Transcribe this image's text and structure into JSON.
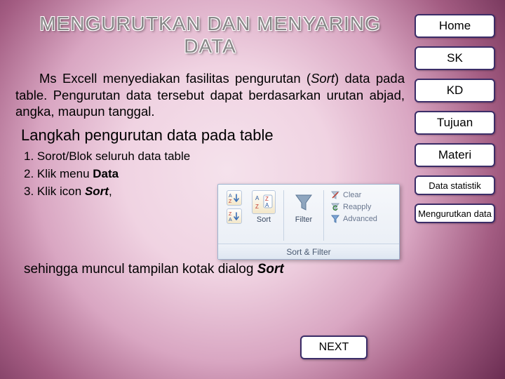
{
  "title": "MENGURUTKAN DAN MENYARING DATA",
  "paragraph": {
    "prefix": "Ms Excell menyediakan fasilitas pengurutan (",
    "sort_word": "Sort",
    "suffix": ") data pada table. Pengurutan data tersebut dapat berdasarkan urutan abjad, angka, maupun tanggal."
  },
  "subheading": "Langkah pengurutan data pada table",
  "steps": {
    "s1": "1. Sorot/Blok seluruh data table",
    "s2_prefix": "2. Klik menu ",
    "s2_bold": "Data",
    "s3_prefix": "3. Klik icon ",
    "s3_bold": "Sort",
    "s3_suffix": ","
  },
  "continuation": {
    "prefix": "sehingga muncul tampilan kotak dialog ",
    "bold": "Sort"
  },
  "nav": {
    "home": "Home",
    "sk": "SK",
    "kd": "KD",
    "tujuan": "Tujuan",
    "materi": "Materi",
    "data_stat": "Data statistik",
    "mengurutkan": "Mengurutkan data"
  },
  "ribbon": {
    "sort_label": "Sort",
    "filter_label": "Filter",
    "clear": "Clear",
    "reapply": "Reapply",
    "advanced": "Advanced",
    "group": "Sort & Filter"
  },
  "next": "NEXT"
}
